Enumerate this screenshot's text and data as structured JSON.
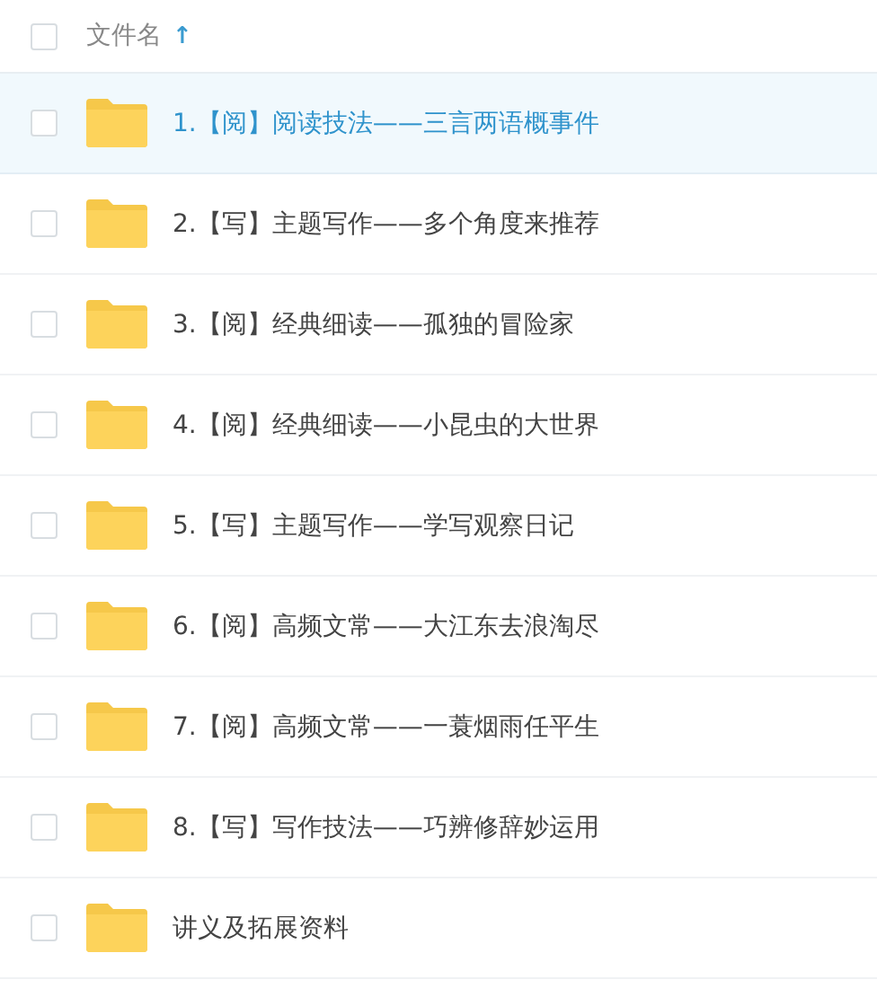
{
  "header": {
    "column": "文件名",
    "sort_arrow": "↑",
    "checked": false
  },
  "files": [
    {
      "name": "1.【阅】阅读技法——三言两语概事件",
      "selected": true,
      "checked": false
    },
    {
      "name": "2.【写】主题写作——多个角度来推荐",
      "selected": false,
      "checked": false
    },
    {
      "name": "3.【阅】经典细读——孤独的冒险家",
      "selected": false,
      "checked": false
    },
    {
      "name": "4.【阅】经典细读——小昆虫的大世界",
      "selected": false,
      "checked": false
    },
    {
      "name": "5.【写】主题写作——学写观察日记",
      "selected": false,
      "checked": false
    },
    {
      "name": "6.【阅】高频文常——大江东去浪淘尽",
      "selected": false,
      "checked": false
    },
    {
      "name": "7.【阅】高频文常——一蓑烟雨任平生",
      "selected": false,
      "checked": false
    },
    {
      "name": "8.【写】写作技法——巧辨修辞妙运用",
      "selected": false,
      "checked": false
    },
    {
      "name": "讲义及拓展资料",
      "selected": false,
      "checked": false
    }
  ]
}
